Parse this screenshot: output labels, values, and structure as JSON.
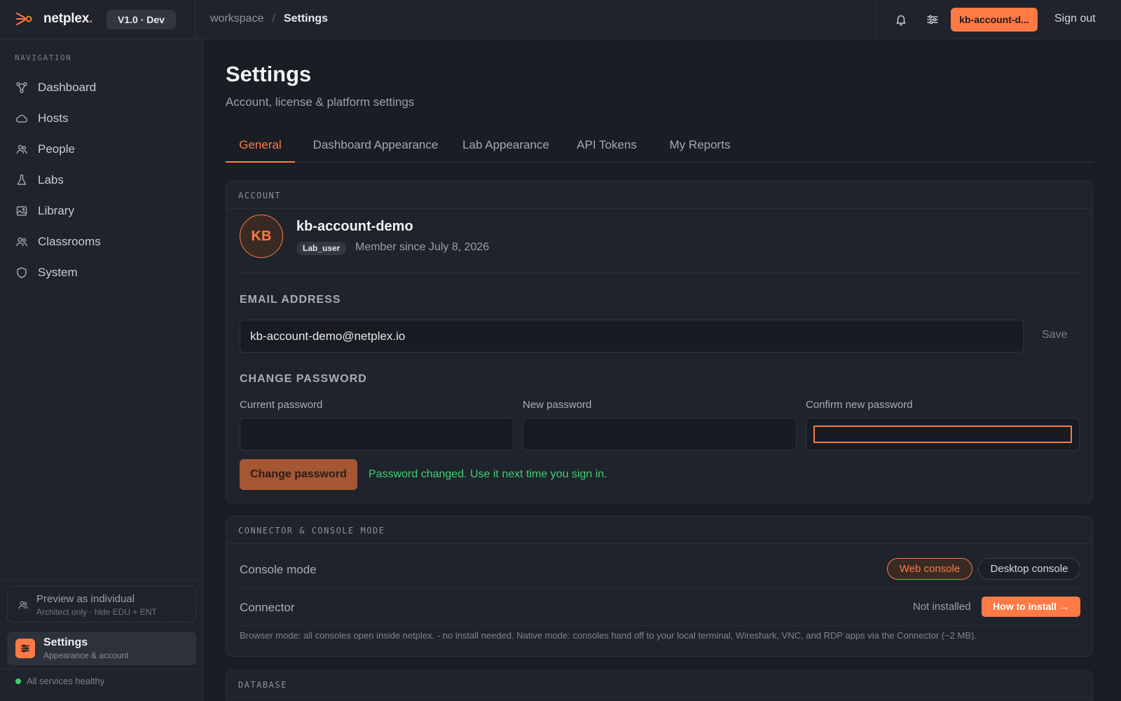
{
  "topbar": {
    "brand": "netplex",
    "brand_dot": ".",
    "version": "V1.0 · Dev",
    "breadcrumb": [
      "workspace",
      "/",
      "Settings"
    ],
    "account_label": "kb-account-d...",
    "signout_label": "Sign out",
    "icons": [
      "bell-icon",
      "sliders-icon"
    ]
  },
  "sidebar": {
    "heading": "NAVIGATION",
    "items": [
      {
        "label": "Dashboard",
        "icon": "graph-icon"
      },
      {
        "label": "Hosts",
        "icon": "cloud-icon"
      },
      {
        "label": "People",
        "icon": "people-icon"
      },
      {
        "label": "Labs",
        "icon": "flask-icon"
      },
      {
        "label": "Library",
        "icon": "image-icon"
      },
      {
        "label": "Classrooms",
        "icon": "classroom-icon"
      },
      {
        "label": "System",
        "icon": "shield-icon"
      }
    ],
    "preview": {
      "title": "Preview as individual",
      "subtitle": "Architect only · hide EDU + ENT"
    },
    "settings": {
      "title": "Settings",
      "subtitle": "Appearance & account"
    },
    "health": "All services healthy"
  },
  "main": {
    "title": "Settings",
    "subtitle": "Account, license & platform settings",
    "tabs": [
      {
        "label": "General",
        "active": true
      },
      {
        "label": "Dashboard Appearance",
        "active": false
      },
      {
        "label": "Lab Appearance",
        "active": false
      },
      {
        "label": "API Tokens",
        "active": false
      },
      {
        "label": "My Reports",
        "active": false
      }
    ]
  },
  "account": {
    "section_title": "ACCOUNT",
    "initials": "KB",
    "name": "kb-account-demo",
    "role": "Lab_user",
    "member_since": "Member since July 8, 2026",
    "email_heading": "EMAIL ADDRESS",
    "email_value": "kb-account-demo@netplex.io",
    "save_label": "Save",
    "password_heading": "CHANGE PASSWORD",
    "current_password_label": "Current password",
    "new_password_label": "New password",
    "confirm_password_label": "Confirm new password",
    "change_button": "Change password",
    "success_message": "Password changed. Use it next time you sign in."
  },
  "connector": {
    "section_title": "CONNECTOR & CONSOLE MODE",
    "console_label": "Console mode",
    "web_console": "Web console",
    "desktop_console": "Desktop console",
    "console_selected": "Web console",
    "connector_label": "Connector",
    "connector_status": "Not installed",
    "install_button": "How to install →",
    "footnote": "Browser mode: all consoles open inside netplex. - no install needed. Native mode: consoles hand off to your local terminal, Wireshark, VNC, and RDP apps via the Connector (~2 MB)."
  },
  "database": {
    "section_title": "DATABASE"
  },
  "colors": {
    "accent": "#ff7a45",
    "success": "#3ecf74",
    "background": "#1a1d24",
    "panel": "#1f232b"
  }
}
